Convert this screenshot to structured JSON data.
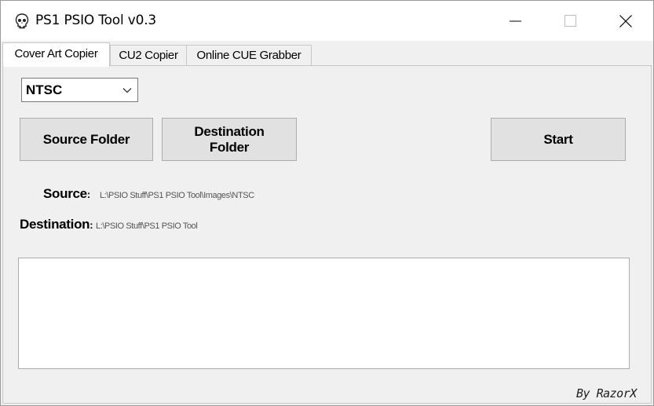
{
  "window": {
    "title": "PS1 PSIO Tool v0.3",
    "icon": "skull-icon",
    "controls": [
      "minimize-icon",
      "maximize-icon",
      "close-icon"
    ]
  },
  "tabs": [
    {
      "label": "Cover Art Copier",
      "active": true
    },
    {
      "label": "CU2 Copier",
      "active": false
    },
    {
      "label": "Online CUE Grabber",
      "active": false
    }
  ],
  "region_select": {
    "selected": "NTSC"
  },
  "buttons": {
    "source_line1": "Source Folder",
    "dest_line1": "Destination",
    "dest_line2": "Folder",
    "start": "Start"
  },
  "paths": {
    "source_label": "Source",
    "source_colon": ":",
    "source_value": "L:\\PSIO Stuff\\PS1 PSIO Tool\\Images\\NTSC",
    "dest_label": "Destination",
    "dest_colon": ":",
    "dest_value": "L:\\PSIO Stuff\\PS1 PSIO Tool"
  },
  "log": {
    "content": ""
  },
  "credit": "By RazorX"
}
